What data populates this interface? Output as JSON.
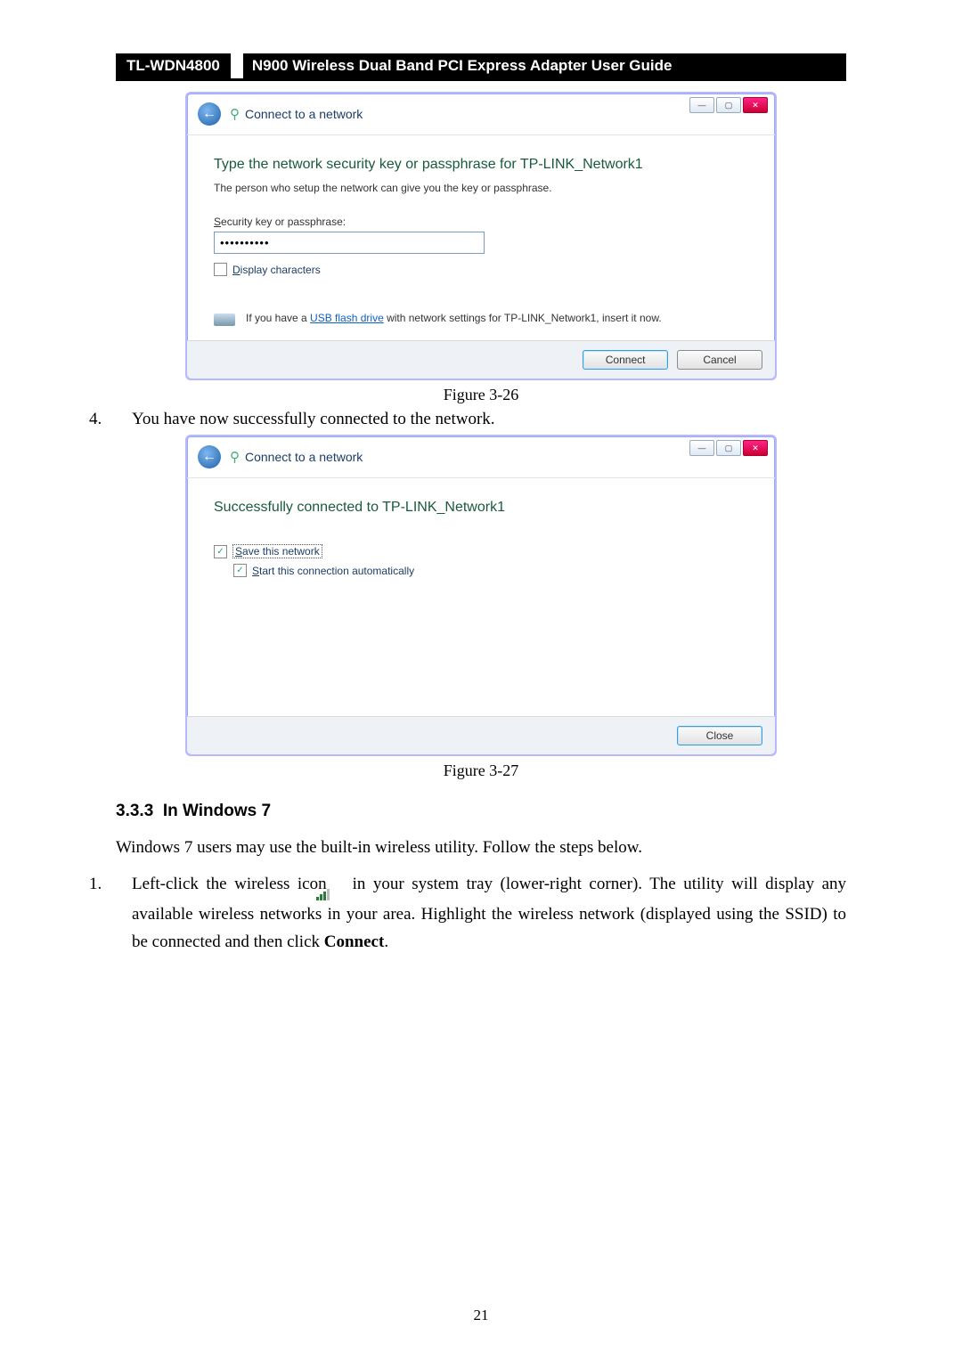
{
  "header": {
    "model": "TL-WDN4800",
    "title": "N900 Wireless Dual Band PCI Express Adapter User Guide"
  },
  "dlg1": {
    "title": "Connect to a network",
    "instruction": "Type the network security key or passphrase for TP-LINK_Network1",
    "sub": "The person who setup the network can give you the key or passphrase.",
    "label_prefix": "S",
    "label_rest": "ecurity key or passphrase:",
    "value": "••••••••••",
    "disp_prefix": "D",
    "disp_rest": "isplay characters",
    "usb_pre": "If you have a ",
    "usb_link": "USB flash drive",
    "usb_post": " with network settings for TP-LINK_Network1, insert it now.",
    "btn_connect": "Connect",
    "btn_cancel": "Cancel"
  },
  "caption1": "Figure 3-26",
  "step4": {
    "num": "4.",
    "text": "You have now successfully connected to the network."
  },
  "dlg2": {
    "title": "Connect to a network",
    "msg": "Successfully connected to TP-LINK_Network1",
    "save_prefix": "S",
    "save_rest": "ave this network",
    "start_prefix": "S",
    "start_rest": "tart this connection automatically",
    "btn_close": "Close"
  },
  "caption2": "Figure 3-27",
  "section": {
    "num": "3.3.3",
    "title": "In Windows 7"
  },
  "intro": "Windows 7 users may use the built-in wireless utility. Follow the steps below.",
  "step1": {
    "num": "1.",
    "pre": "Left-click the wireless icon ",
    "post": " in your system tray (lower-right corner). The utility will display any available wireless networks in your area. Highlight the wireless network (displayed using the SSID) to be connected and then click ",
    "bold": "Connect",
    "end": "."
  },
  "page_no": "21"
}
